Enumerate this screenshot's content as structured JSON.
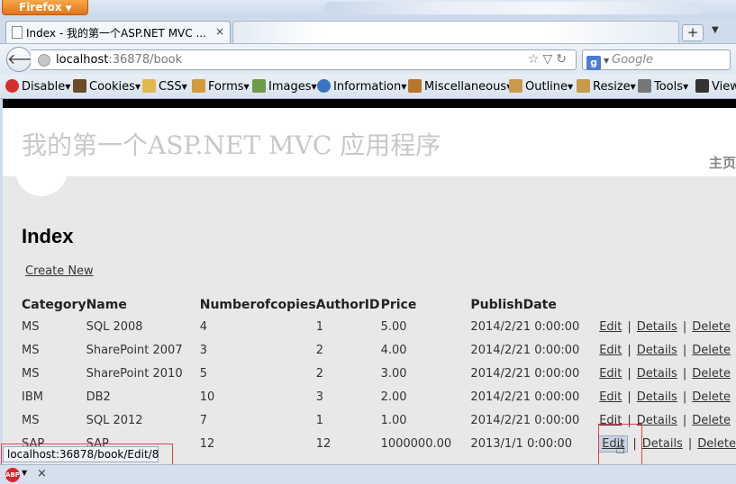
{
  "browser": {
    "menu_button": "Firefox",
    "tab_title": "Index - 我的第一个ASP.NET MVC ...",
    "tab_close": "×",
    "new_tab": "+",
    "url_host": "localhost",
    "url_rest": ":36878/book",
    "search_placeholder": "Google",
    "status_link": "localhost:36878/book/Edit/8"
  },
  "webdev_toolbar": {
    "items": [
      "Disable",
      "Cookies",
      "CSS",
      "Forms",
      "Images",
      "Information",
      "Miscellaneous",
      "Outline",
      "Resize",
      "Tools",
      "View"
    ]
  },
  "page": {
    "site_title": "我的第一个ASP.NET MVC 应用程序",
    "home_link": "主页",
    "heading": "Index",
    "create_link": "Create New"
  },
  "table": {
    "headers": [
      "Category",
      "Name",
      "Numberofcopies",
      "AuthorID",
      "Price",
      "PublishDate"
    ],
    "rows": [
      [
        "MS",
        "SQL 2008",
        "4",
        "1",
        "5.00",
        "2014/2/21 0:00:00"
      ],
      [
        "MS",
        "SharePoint 2007",
        "3",
        "2",
        "4.00",
        "2014/2/21 0:00:00"
      ],
      [
        "MS",
        "SharePoint 2010",
        "5",
        "2",
        "3.00",
        "2014/2/21 0:00:00"
      ],
      [
        "IBM",
        "DB2",
        "10",
        "3",
        "2.00",
        "2014/2/21 0:00:00"
      ],
      [
        "MS",
        "SQL 2012",
        "7",
        "1",
        "1.00",
        "2014/2/21 0:00:00"
      ],
      [
        "SAP",
        "SAP",
        "12",
        "12",
        "1000000.00",
        "2013/1/1 0:00:00"
      ]
    ],
    "actions": {
      "edit": "Edit",
      "details": "Details",
      "delete": "Delete",
      "separator": "|"
    }
  },
  "colors": {
    "highlight_box": "#e0404a",
    "ff_orange": "#e1731b"
  }
}
